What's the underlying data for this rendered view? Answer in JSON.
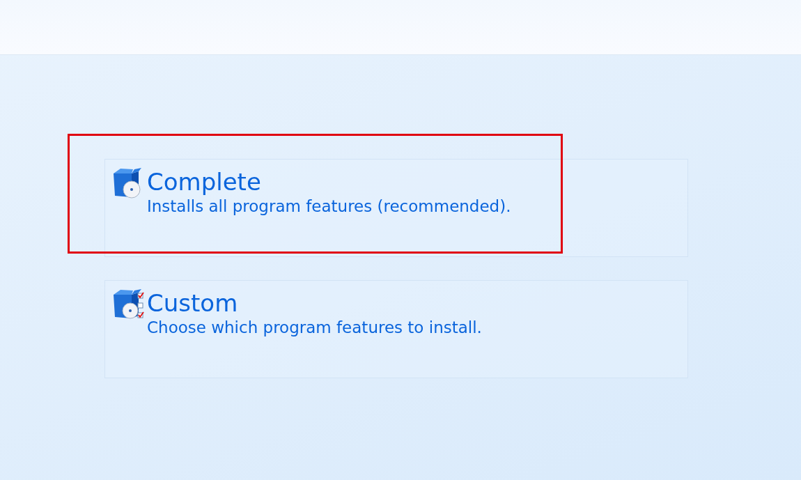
{
  "options": [
    {
      "kind": "disc",
      "title": "Complete",
      "description": "Installs all program features (recommended).",
      "highlighted": true
    },
    {
      "kind": "checklist",
      "title": "Custom",
      "description": "Choose which program features to install.",
      "highlighted": false
    }
  ]
}
